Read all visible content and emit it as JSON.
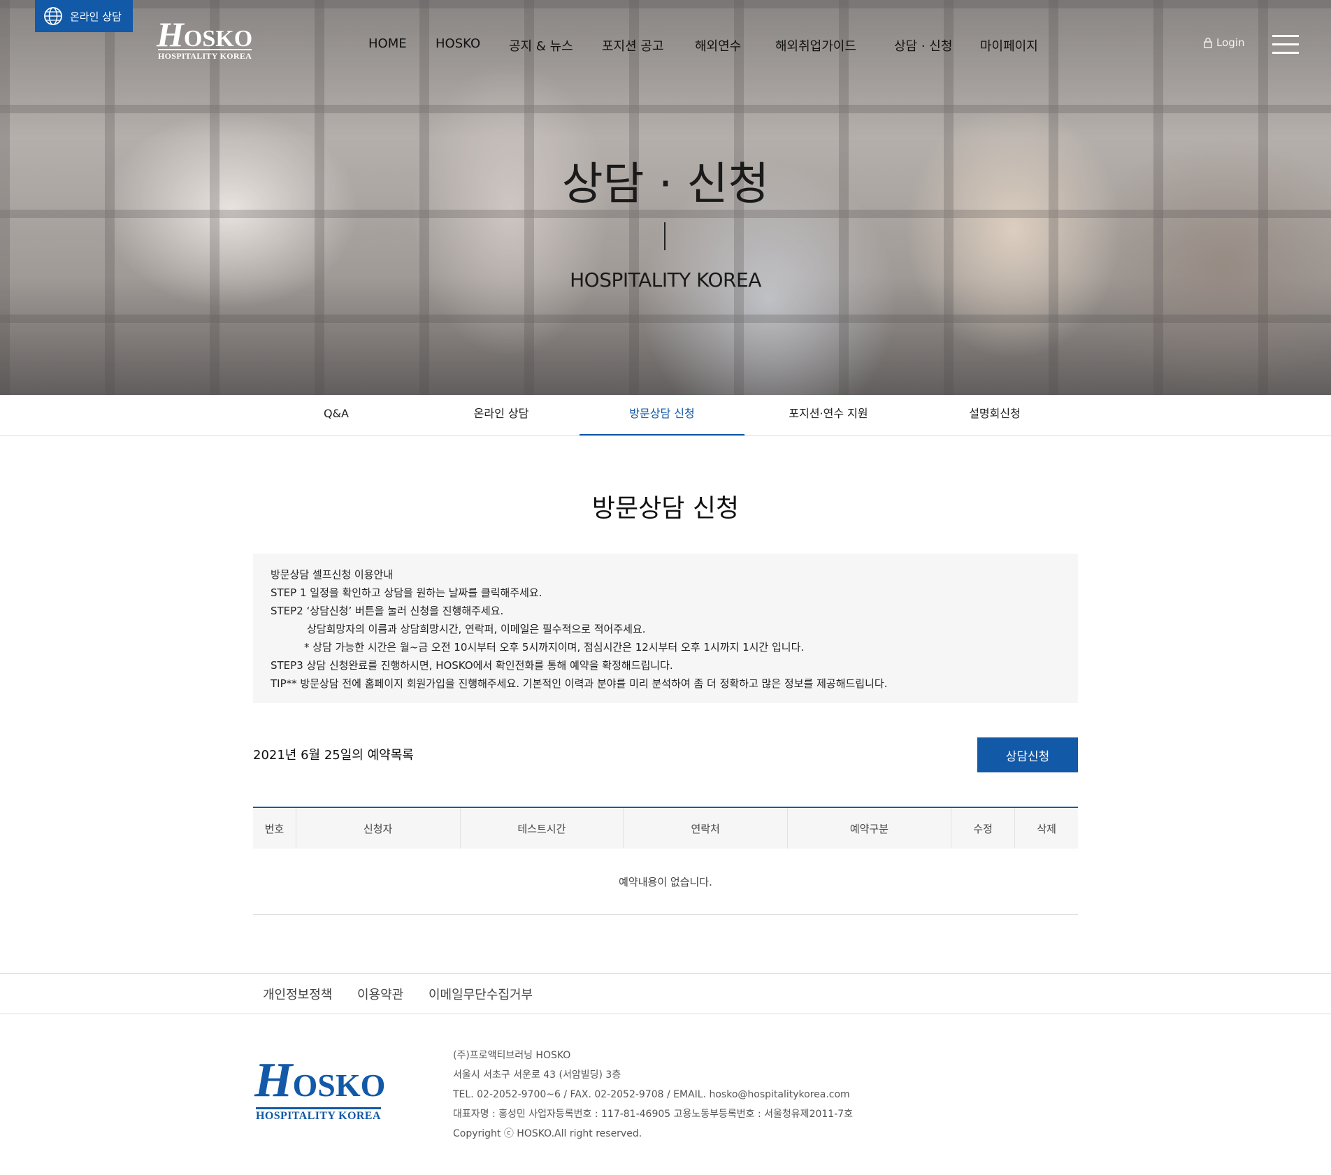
{
  "top_badge": {
    "label": "온라인 상담",
    "icon": "globe-icon"
  },
  "logo": {
    "main": "HOSKO",
    "sub": "HOSPITALITY KOREA"
  },
  "gnb": [
    "HOME",
    "HOSKO",
    "공지 & 뉴스",
    "포지션 공고",
    "해외연수",
    "해외취업가이드",
    "상담 · 신청",
    "마이페이지"
  ],
  "login": {
    "label": "Login",
    "icon": "lock-icon"
  },
  "menu_icon": "hamburger-icon",
  "hero": {
    "title": "상담 · 신청",
    "subtitle": "HOSPITALITY KOREA"
  },
  "subtabs": {
    "items": [
      "Q&A",
      "온라인 상담",
      "방문상담 신청",
      "포지션·연수 지원",
      "설명회신청"
    ],
    "active": "방문상담 신청"
  },
  "page_title": "방문상담 신청",
  "guide": {
    "lines": [
      "방문상담 셀프신청 이용안내",
      "STEP 1 일정을 확인하고 상담을 원하는 날짜를 클릭해주세요.",
      "STEP2 ‘상담신청’ 버튼을 눌러 신청을 진행해주세요.",
      "상담희망자의 이름과 상담희망시간, 연락퍼, 이메일은 필수적으로 적어주세요.",
      "* 상담 가능한 시간은 월~금 오전 10시부터 오후 5시까지이며, 점심시간은 12시부터 오후 1시까지 1시간 입니다.",
      "STEP3 상담 신청완료를 진행하시면, HOSKO에서 확인전화를 통해 예약을 확정해드립니다.",
      "TIP** 방문상담 전에 홈페이지 회원가입을 진행해주세요. 기본적인 이력과 분야를 미리 분석하여 좀 더 정확하고 많은 정보를 제공해드립니다."
    ]
  },
  "reservation": {
    "date_label": "2021년 6월 25일의 예약목록",
    "apply_button": "상담신청",
    "columns": [
      "번호",
      "신청자",
      "테스트시간",
      "연락처",
      "예약구분",
      "수정",
      "삭제"
    ],
    "empty_message": "예약내용이 없습니다."
  },
  "footer": {
    "links": [
      "개인정보정책",
      "이용약관",
      "이메일무단수집거부"
    ],
    "company_lines": [
      "(주)프로액티브러닝 HOSKO",
      "서울시 서초구 서운로 43 (서암빌딩) 3층",
      "TEL. 02-2052-9700~6 / FAX. 02-2052-9708 / EMAIL. hosko@hospitalitykorea.com",
      "대표자명 : 홍성민 사업자등록번호 : 117-81-46905 고용노동부등록번호 : 서울청유제2011-7호",
      "Copyright ⓒ HOSKO.All right reserved."
    ]
  },
  "colors": {
    "brand_blue": "#1259a8",
    "guide_bg": "#f6f6f6"
  }
}
